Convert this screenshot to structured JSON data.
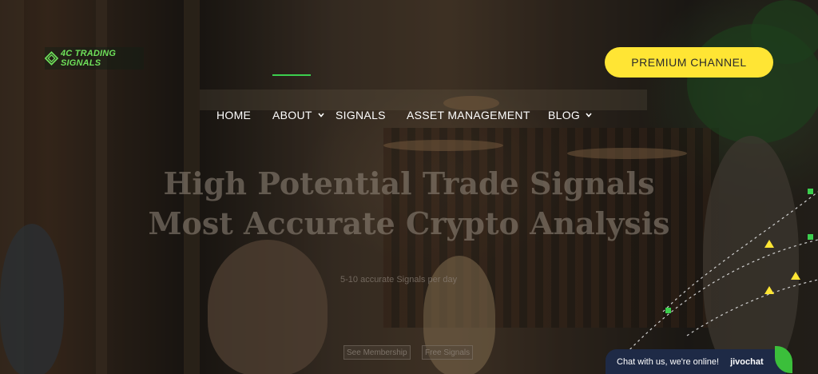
{
  "brand": {
    "logo_text": "4C TRADING SIGNALS"
  },
  "nav": {
    "items": [
      {
        "label": "HOME",
        "has_dropdown": false,
        "active": false
      },
      {
        "label": "ABOUT",
        "has_dropdown": true,
        "active": true
      },
      {
        "label": "SIGNALS",
        "has_dropdown": false,
        "active": false
      },
      {
        "label": "ASSET MANAGEMENT",
        "has_dropdown": false,
        "active": false
      },
      {
        "label": "BLOG",
        "has_dropdown": true,
        "active": false
      }
    ],
    "cta_label": "PREMIUM CHANNEL"
  },
  "hero": {
    "headline_line1": "High Potential Trade Signals",
    "headline_line2": "Most Accurate Crypto Analysis",
    "subline": "5-10 accurate Signals per day",
    "button_membership": "See Membership",
    "button_free": "Free Signals"
  },
  "chat": {
    "label": "Chat with us, we're online!",
    "brand": "jivochat"
  },
  "colors": {
    "accent_green": "#3ccf4e",
    "cta_yellow": "#ffe534",
    "chat_navy": "#1e2a46"
  },
  "icons": [
    "logo-mark-icon",
    "chevron-down-icon",
    "chat-leaf-icon"
  ]
}
